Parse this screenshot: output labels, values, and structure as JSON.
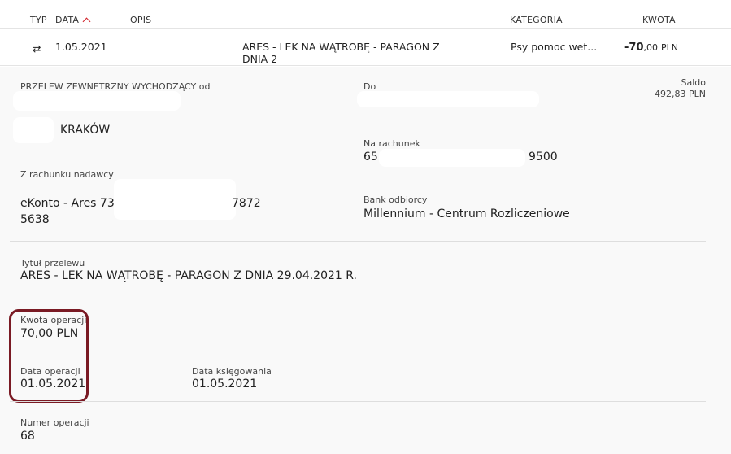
{
  "header": {
    "col_type": "TYP",
    "col_date": "DATA",
    "col_desc": "OPIS",
    "col_category": "KATEGORIA",
    "col_amount": "KWOTA"
  },
  "transaction": {
    "date": "1.05.2021",
    "description": "ARES - LEK NA WĄTROBĘ - PARAGON Z DNIA 2",
    "category": "Psy pomoc wet...",
    "amount_int": "-70",
    "amount_dec": ",00",
    "currency": "PLN",
    "icon": "transfer-arrows-icon"
  },
  "details": {
    "transfer_type": "PRZELEW ZEWNETRZNY WYCHODZĄCY od",
    "sender_city": "KRAKÓW",
    "to_label": "Do",
    "balance_label": "Saldo",
    "balance_value": "492,83 PLN",
    "account_label": "Na rachunek",
    "account_prefix": "65",
    "account_suffix": "9500",
    "from_account_label": "Z rachunku nadawcy",
    "from_account_name": "eKonto - Ares 73",
    "from_account_mid": "7872",
    "from_account_end": "5638",
    "bank_label": "Bank odbiorcy",
    "bank_value": "Millennium - Centrum Rozliczeniowe",
    "title_label": "Tytuł przelewu",
    "title_value": "ARES - LEK NA WĄTROBĘ - PARAGON Z DNIA 29.04.2021 R.",
    "op_amount_label": "Kwota operacji",
    "op_amount_value": "70,00 PLN",
    "op_date_label": "Data operacji",
    "op_date_value": "01.05.2021",
    "book_date_label": "Data księgowania",
    "book_date_value": "01.05.2021",
    "op_number_label": "Numer operacji",
    "op_number_value": "68"
  },
  "colors": {
    "accent": "#d2232a",
    "highlight_border": "#7a1a24",
    "transfer_icon": "#3ba55c"
  }
}
